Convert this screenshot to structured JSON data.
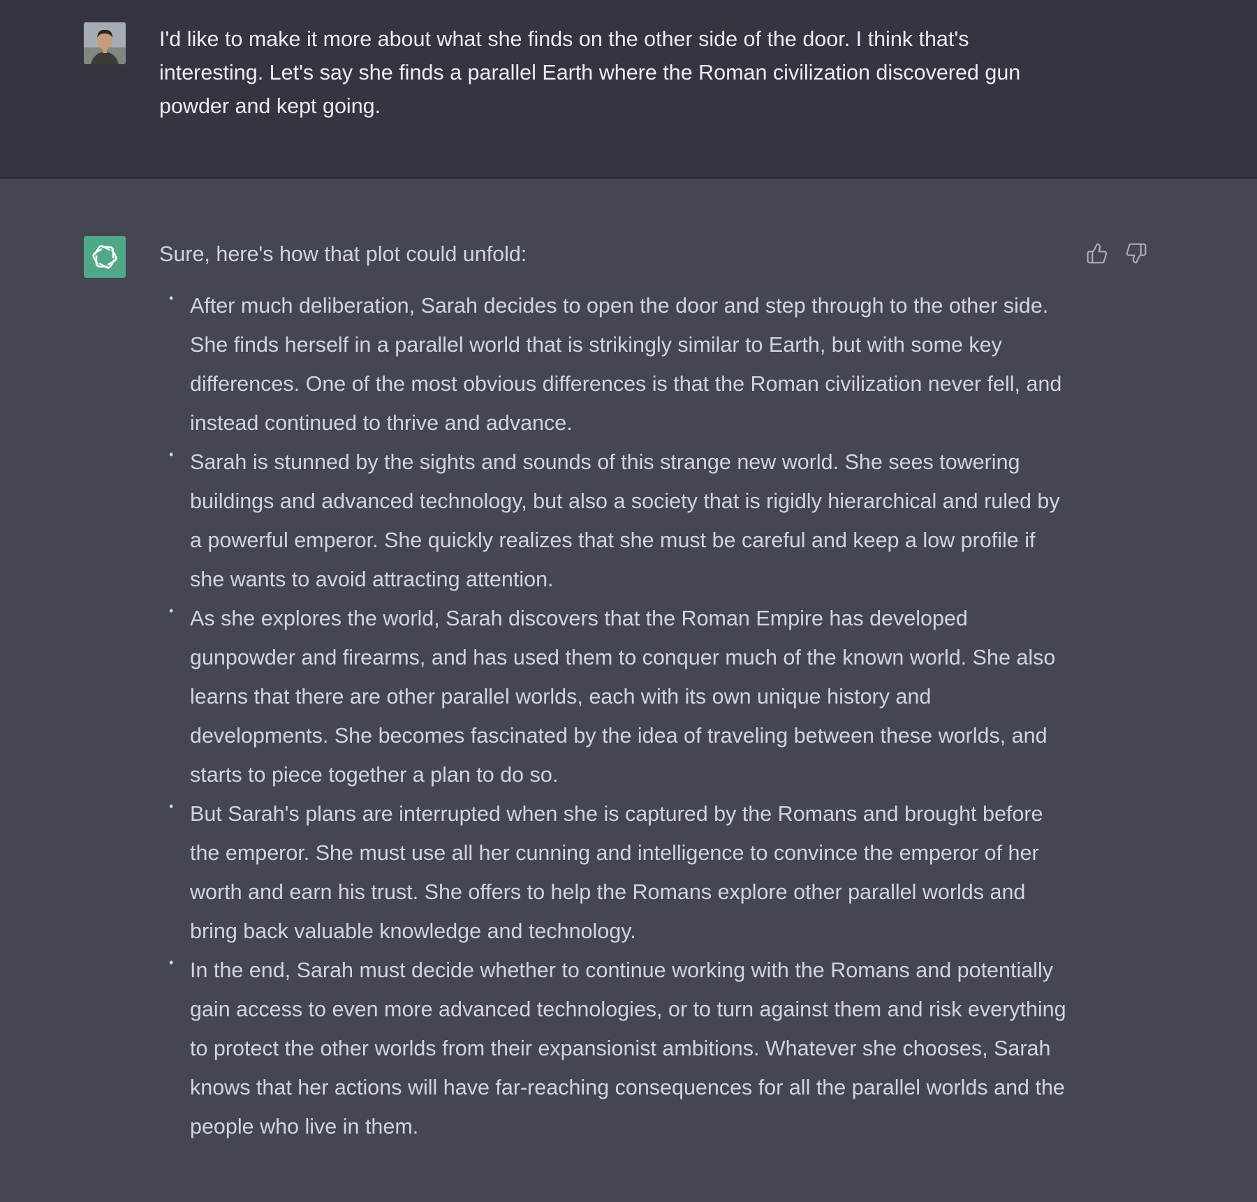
{
  "user_message": {
    "text": "I'd like to make it more about what she finds on the other side of the door. I think that's interesting. Let's say she finds a parallel Earth where the Roman civilization discovered gun powder and kept going."
  },
  "assistant_message": {
    "intro": "Sure, here's how that plot could unfold:",
    "bullets": [
      "After much deliberation, Sarah decides to open the door and step through to the other side. She finds herself in a parallel world that is strikingly similar to Earth, but with some key differences. One of the most obvious differences is that the Roman civilization never fell, and instead continued to thrive and advance.",
      "Sarah is stunned by the sights and sounds of this strange new world. She sees towering buildings and advanced technology, but also a society that is rigidly hierarchical and ruled by a powerful emperor. She quickly realizes that she must be careful and keep a low profile if she wants to avoid attracting attention.",
      "As she explores the world, Sarah discovers that the Roman Empire has developed gunpowder and firearms, and has used them to conquer much of the known world. She also learns that there are other parallel worlds, each with its own unique history and developments. She becomes fascinated by the idea of traveling between these worlds, and starts to piece together a plan to do so.",
      "But Sarah's plans are interrupted when she is captured by the Romans and brought before the emperor. She must use all her cunning and intelligence to convince the emperor of her worth and earn his trust. She offers to help the Romans explore other parallel worlds and bring back valuable knowledge and technology.",
      "In the end, Sarah must decide whether to continue working with the Romans and potentially gain access to even more advanced technologies, or to turn against them and risk everything to protect the other worlds from their expansionist ambitions. Whatever she chooses, Sarah knows that her actions will have far-reaching consequences for all the parallel worlds and the people who live in them."
    ],
    "bullet_symbol": "•"
  },
  "icons": {
    "user_avatar": "user-avatar",
    "assistant_avatar": "openai-logo-icon",
    "thumbs_up": "thumbs-up-icon",
    "thumbs_down": "thumbs-down-icon"
  },
  "colors": {
    "user_bg": "#343541",
    "assistant_bg": "#444654",
    "assistant_avatar_bg": "#4fa888",
    "user_text": "#ececf1",
    "assistant_text": "#d1d5db"
  }
}
